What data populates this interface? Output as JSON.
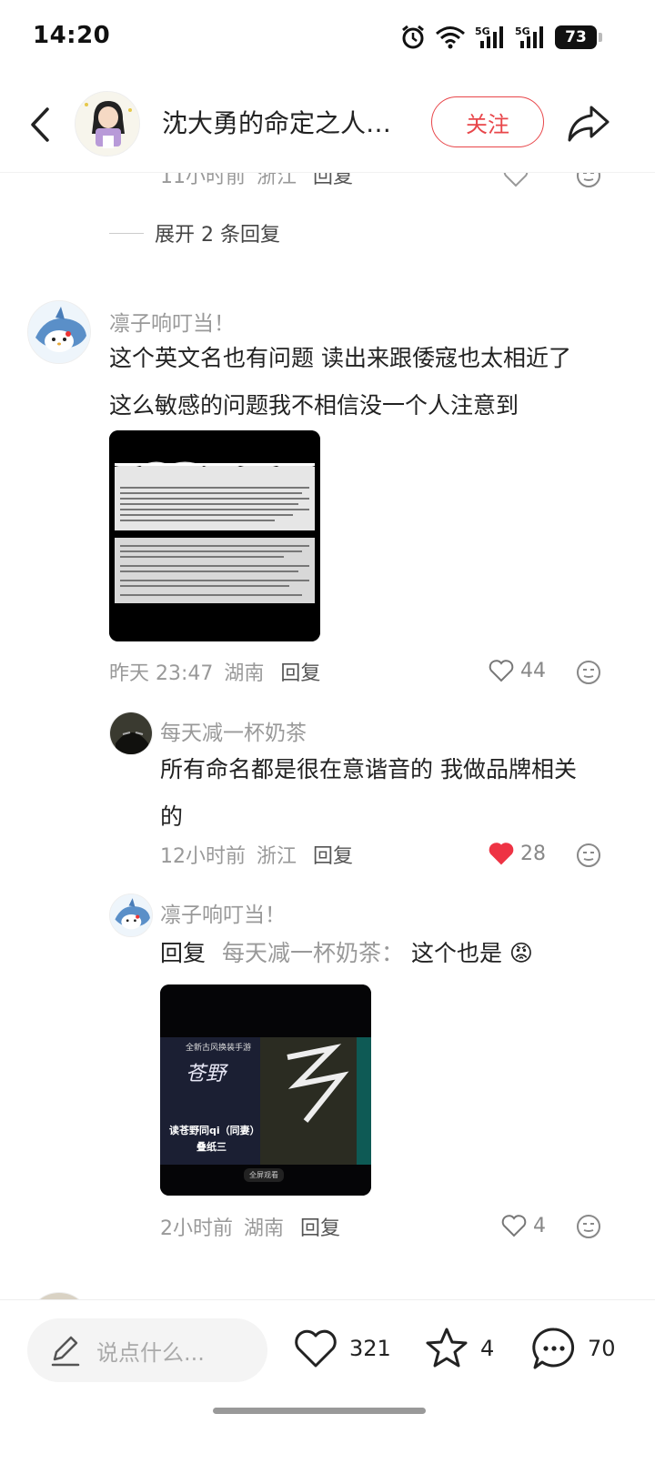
{
  "status_bar": {
    "time": "14:20",
    "battery": "73",
    "network_label": "5G"
  },
  "header": {
    "title": "沈大勇的命定之人…",
    "follow_label": "关注"
  },
  "thread": {
    "prev_meta": {
      "time": "11小时前",
      "location": "浙江",
      "reply_label": "回复"
    },
    "expand_label": "展开 2 条回复",
    "main_comment": {
      "username": "凛子响叮当！",
      "text_line1": "这个英文名也有问题 读出来跟倭寇也太相近了",
      "text_line2": "这么敏感的问题我不相信没一个人注意到",
      "time": "昨天 23:47",
      "location": "湖南",
      "reply_label": "回复",
      "likes": "44"
    },
    "reply1": {
      "username": "每天减一杯奶茶",
      "text_line1": "所有命名都是很在意谐音的 我做品牌相关",
      "text_line2": "的",
      "time": "12小时前",
      "location": "浙江",
      "reply_label": "回复",
      "likes": "28",
      "liked": true
    },
    "reply2": {
      "username": "凛子响叮当！",
      "reply_prefix": "回复",
      "reply_target": "每天减一杯奶茶：",
      "text": "这个也是",
      "emoji": "😡",
      "image_caption_1": "苍野",
      "image_caption_2": "读苍野同qi（同妻）",
      "image_caption_3": "叠纸三",
      "image_small_1": "全新古风换装手游",
      "image_small_2": "全屏观看",
      "time": "2小时前",
      "location": "湖南",
      "reply_label": "回复",
      "likes": "4"
    }
  },
  "bottom_bar": {
    "input_placeholder": "说点什么...",
    "likes": "321",
    "stars": "4",
    "comments": "70"
  },
  "colors": {
    "accent": "#e8464a",
    "like_red": "#ee3344"
  }
}
